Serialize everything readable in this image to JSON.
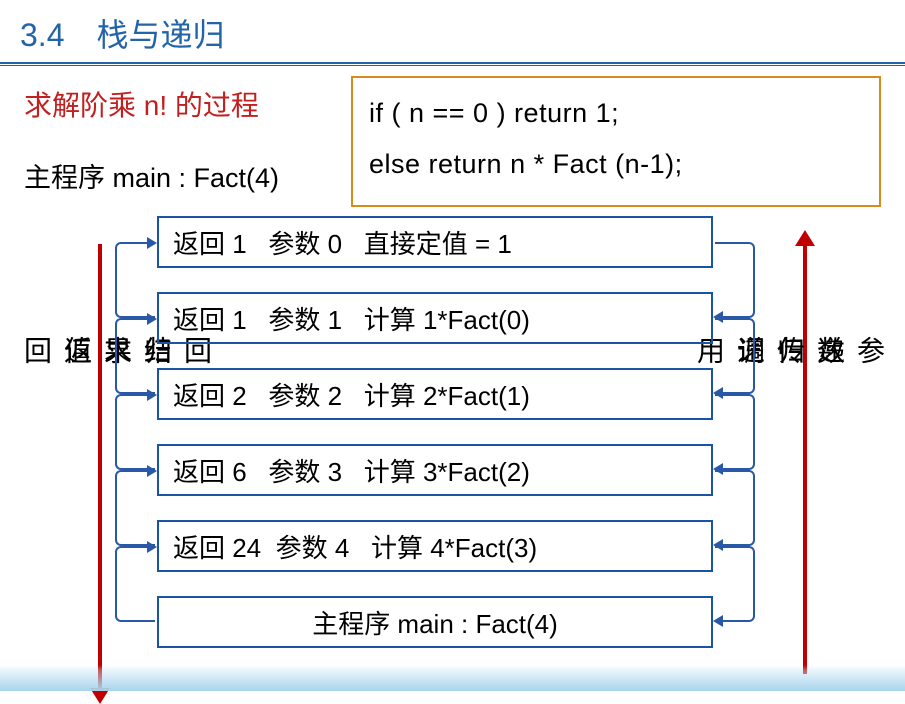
{
  "header": {
    "section_number": "3.4",
    "section_title": "栈与递归"
  },
  "subtitle": "求解阶乘 n! 的过程",
  "code": {
    "line1": "if ( n == 0 ) return 1;",
    "line2": "else return n * Fact (n-1);"
  },
  "main_program_label": "主程序 main : Fact(4)",
  "stack_rows": [
    {
      "ret": "返回 1",
      "param": "参数 0",
      "calc": "直接定值 = 1"
    },
    {
      "ret": "返回 1",
      "param": "参数 1",
      "calc": "计算 1*Fact(0)"
    },
    {
      "ret": "返回 2",
      "param": "参数 2",
      "calc": "计算 2*Fact(1)"
    },
    {
      "ret": "返回 6",
      "param": "参数 3",
      "calc": "计算 3*Fact(2)"
    },
    {
      "ret": "返回 24",
      "param": "参数 4",
      "calc": "计算 4*Fact(3)"
    }
  ],
  "bottom_row": "主程序 main : Fact(4)",
  "vertical_labels": {
    "left_outer": "结果返回",
    "left_inner": "回归求值",
    "right_inner": "递归调用",
    "right_outer": "参数传递"
  }
}
